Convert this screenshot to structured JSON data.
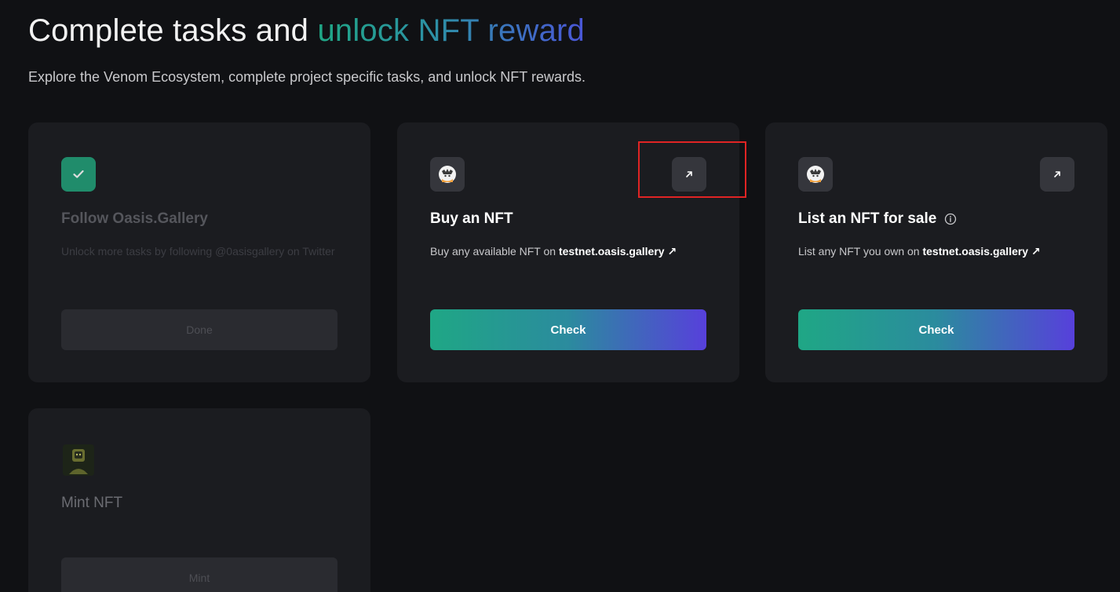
{
  "header": {
    "title_plain": "Complete tasks and ",
    "title_highlight": "unlock NFT reward",
    "subtitle": "Explore the Venom Ecosystem, complete project specific tasks, and unlock NFT rewards."
  },
  "tasks": [
    {
      "title": "Follow Oasis.Gallery",
      "description": "Unlock more tasks by following @0asisgallery on Twitter",
      "button_label": "Done",
      "status": "completed",
      "icon": "check-icon"
    },
    {
      "title": "Buy an NFT",
      "description_prefix": "Buy any available NFT on ",
      "link_text": "testnet.oasis.gallery",
      "button_label": "Check",
      "icon": "oasis-avatar-icon"
    },
    {
      "title": "List an NFT for sale",
      "description_prefix": "List any NFT you own on ",
      "link_text": "testnet.oasis.gallery",
      "button_label": "Check",
      "icon": "oasis-avatar-icon"
    },
    {
      "title": "Mint NFT",
      "button_label": "Mint",
      "status": "locked",
      "icon": "nft-avatar-icon"
    }
  ],
  "colors": {
    "background": "#101114",
    "card": "#1b1c20",
    "accent_green": "#1fa785",
    "accent_purple": "#5740db",
    "highlight_red": "#e02424"
  }
}
